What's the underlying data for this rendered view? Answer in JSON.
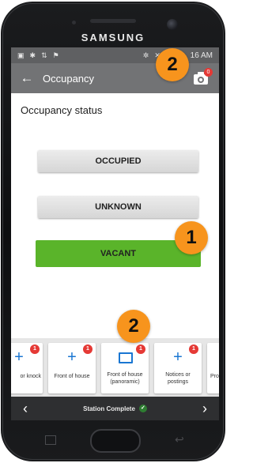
{
  "device": {
    "brand": "SAMSUNG"
  },
  "status_bar": {
    "time": "16 AM"
  },
  "app_bar": {
    "title": "Occupancy",
    "camera_badge": "0"
  },
  "content": {
    "section_title": "Occupancy status",
    "options": [
      {
        "label": "OCCUPIED",
        "color": "#d9d9d9"
      },
      {
        "label": "UNKNOWN",
        "color": "#d9d9d9"
      },
      {
        "label": "VACANT",
        "color": "#5ab42a"
      }
    ]
  },
  "callouts": [
    "2",
    "1",
    "2"
  ],
  "photo_strip": [
    {
      "label": "or knock",
      "icon": "plus-icon",
      "badge": "1"
    },
    {
      "label": "Front of house",
      "icon": "plus-icon",
      "badge": "1"
    },
    {
      "label": "Front of house (panoramic)",
      "icon": "panorama-icon",
      "badge": "1"
    },
    {
      "label": "Notices or postings",
      "icon": "plus-icon",
      "badge": "1"
    },
    {
      "label": "Prope",
      "icon": "plus-icon",
      "badge": ""
    }
  ],
  "bottom_bar": {
    "label": "Station Complete",
    "prev": "‹",
    "next": "›",
    "check": "✓"
  },
  "colors": {
    "accent_orange": "#f7941d",
    "badge_red": "#e53935",
    "vacant_green": "#5ab42a",
    "link_blue": "#1976d2"
  }
}
